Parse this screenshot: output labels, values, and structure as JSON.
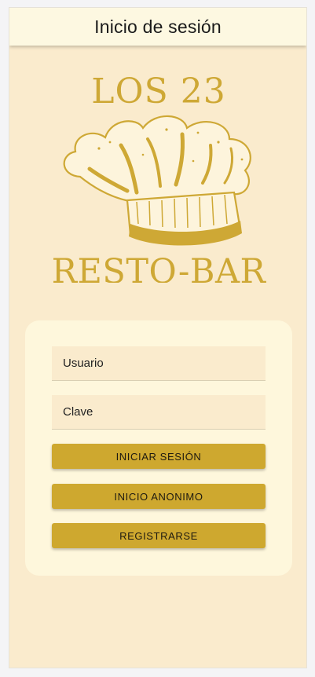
{
  "header": {
    "title": "Inicio de sesión"
  },
  "logo": {
    "line1": "LOS 23",
    "line2": "RESTO-BAR",
    "color": "#cea835"
  },
  "form": {
    "username_placeholder": "Usuario",
    "password_placeholder": "Clave",
    "login_label": "INICIAR SESIÓN",
    "anonymous_label": "INICIO ANONIMO",
    "register_label": "REGISTRARSE"
  },
  "colors": {
    "background": "#faebcd",
    "toolbar": "#fdf8e1",
    "card": "#fef7dc",
    "button": "#cea82f"
  }
}
